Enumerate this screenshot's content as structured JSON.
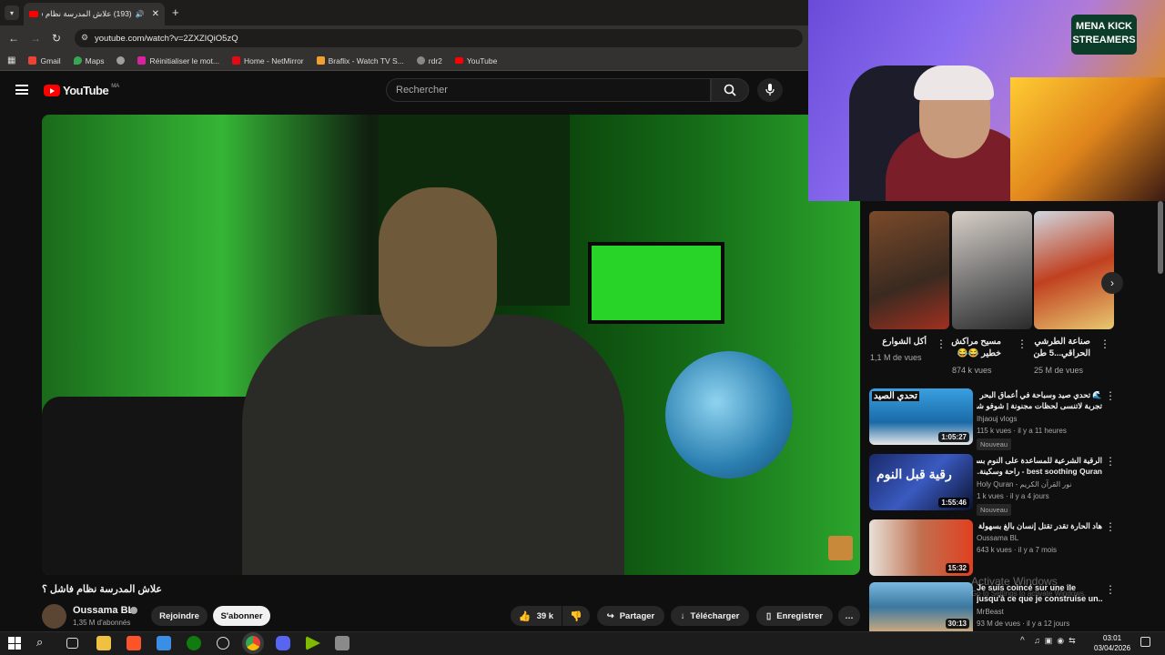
{
  "browser": {
    "tab_title": "(193) علاش المدرسة نظام فا",
    "new_tab": "+",
    "url": "youtube.com/watch?v=2ZXZIQiO5zQ",
    "bookmarks": [
      {
        "label": "Gmail",
        "color": "#ea4335"
      },
      {
        "label": "Maps",
        "color": "#34a853"
      },
      {
        "label": "",
        "color": "#9e9e9e"
      },
      {
        "label": "Réinitialiser le mot...",
        "color": "#d6249f"
      },
      {
        "label": "Home - NetMirror",
        "color": "#e50914"
      },
      {
        "label": "Braflix - Watch TV S...",
        "color": "#f0a030"
      },
      {
        "label": "rdr2",
        "color": "#888888"
      },
      {
        "label": "YouTube",
        "color": "#ff0000"
      }
    ]
  },
  "youtube": {
    "logo": "YouTube",
    "region": "MA",
    "search_placeholder": "Rechercher"
  },
  "video": {
    "title": "علاش المدرسة نظام فاشل ؟",
    "channel": "Oussama BL",
    "subscribers": "1,35 M d'abonnés",
    "join": "Rejoindre",
    "subscribe": "S'abonner",
    "likes": "39 k",
    "share": "Partager",
    "download": "Télécharger",
    "save": "Enregistrer",
    "more": "…"
  },
  "stream": {
    "logo_line1": "MENA KICK",
    "logo_line2": "STREAMERS"
  },
  "shorts": [
    {
      "title": "أكل الشوارع",
      "views": "1,1 M de vues"
    },
    {
      "title": "مسيح مراكش خطير 😂😂",
      "views": "874 k vues"
    },
    {
      "title": "صناعة الطرشي الحراقي...5 طن",
      "views": "25 M de vues"
    }
  ],
  "recommended": [
    {
      "title": "🌊 تحدي صيد وسباحة في أعماق البحر",
      "title2": "تجربة لاتنسى لحظات مجنونة | شوفو شنو...",
      "channel": "Ihjaouj vlogs",
      "meta": "115 k vues · il y a 11 heures",
      "badge": "Nouveau",
      "duration": "1:05:27",
      "thumb_text": "تحدي الصيد"
    },
    {
      "title": "الرقية الشرعية للمساعدة على النوم بسهولة",
      "title2": "best soothing Quran - راحة وسكينة...",
      "channel": "Holy Quran - نور القرآن الكريم",
      "meta": "1 k vues · il y a 4 jours",
      "badge": "Nouveau",
      "duration": "1:55:46",
      "thumb_text": "رقية قبل النوم"
    },
    {
      "title": "هاد الحارة تقدر تقتل إنسان بالغ بسهولة !",
      "title2": "",
      "channel": "Oussama BL",
      "meta": "643 k vues · il y a 7 mois",
      "badge": "",
      "duration": "15:32",
      "thumb_text": ""
    },
    {
      "title": "Je suis coincé sur une île",
      "title2": "jusqu'à ce que je construise un...",
      "channel": "MrBeast",
      "meta": "93 M de vues · il y a 12 jours",
      "badge": "",
      "duration": "30:13",
      "thumb_text": ""
    }
  ],
  "watermark": {
    "line1": "Activate Windows",
    "line2": "Go to Settings to activate Windows."
  },
  "taskbar": {
    "time": "03:01",
    "date": "03/04/2026"
  }
}
